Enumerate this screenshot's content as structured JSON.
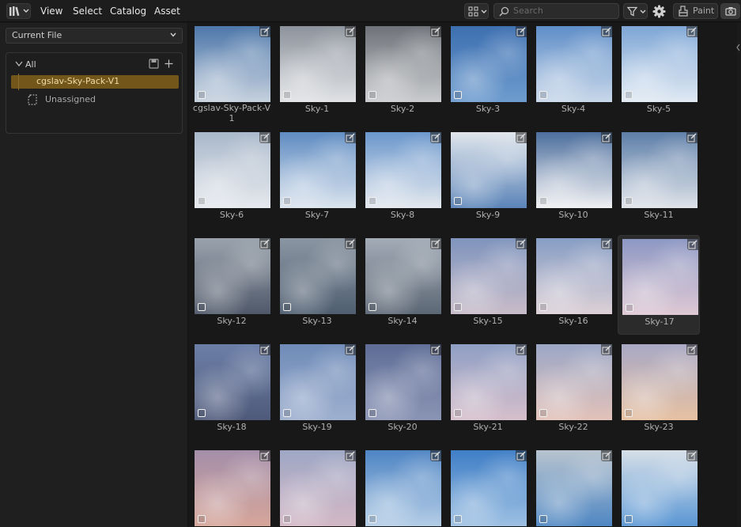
{
  "header": {
    "menu": [
      "View",
      "Select",
      "Catalog",
      "Asset"
    ],
    "search_placeholder": "Search",
    "paint_label": "Paint"
  },
  "sidebar": {
    "library": "Current File",
    "catalog_root": "All",
    "catalogs": [
      "cgslav-Sky-Pack-V1",
      "Unassigned"
    ]
  },
  "assets": [
    {
      "name": "cgslav-Sky-Pack-V1",
      "top": "#4d77aa",
      "bottom": "#c6d1de"
    },
    {
      "name": "Sky-1",
      "top": "#8d939c",
      "bottom": "#e0e2e5"
    },
    {
      "name": "Sky-2",
      "top": "#6f7379",
      "bottom": "#c9cbce"
    },
    {
      "name": "Sky-3",
      "top": "#3d6fb0",
      "bottom": "#6e9ccf"
    },
    {
      "name": "Sky-4",
      "top": "#5f8ec8",
      "bottom": "#c9d8ea"
    },
    {
      "name": "Sky-5",
      "top": "#7ea6d6",
      "bottom": "#e1eaf3"
    },
    {
      "name": "Sky-6",
      "top": "#a9b8ca",
      "bottom": "#e6e9ee"
    },
    {
      "name": "Sky-7",
      "top": "#5f8cc2",
      "bottom": "#dbe4ee"
    },
    {
      "name": "Sky-8",
      "top": "#6b97cc",
      "bottom": "#e3e8ee"
    },
    {
      "name": "Sky-9",
      "top": "#e1e6ec",
      "bottom": "#5b84b8"
    },
    {
      "name": "Sky-10",
      "top": "#4d6f9e",
      "bottom": "#f0f0f2"
    },
    {
      "name": "Sky-11",
      "top": "#5d7ea8",
      "bottom": "#dfe3e9"
    },
    {
      "name": "Sky-12",
      "top": "#9aa3ad",
      "bottom": "#50596a"
    },
    {
      "name": "Sky-13",
      "top": "#8b96a3",
      "bottom": "#4f5e70"
    },
    {
      "name": "Sky-14",
      "top": "#a3acb7",
      "bottom": "#5c6775"
    },
    {
      "name": "Sky-15",
      "top": "#7f94bd",
      "bottom": "#c8bcc9"
    },
    {
      "name": "Sky-16",
      "top": "#879dc4",
      "bottom": "#dcd0d6"
    },
    {
      "name": "Sky-17",
      "top": "#8d98c4",
      "bottom": "#dfc9d4"
    },
    {
      "name": "Sky-18",
      "top": "#6c7fa8",
      "bottom": "#4f5a7a"
    },
    {
      "name": "Sky-19",
      "top": "#6f8bb8",
      "bottom": "#9eb0cf"
    },
    {
      "name": "Sky-20",
      "top": "#5f6d97",
      "bottom": "#8a94b4"
    },
    {
      "name": "Sky-21",
      "top": "#8f9fc4",
      "bottom": "#d6bfcb"
    },
    {
      "name": "Sky-22",
      "top": "#9ba7c6",
      "bottom": "#e3c2b9"
    },
    {
      "name": "Sky-23",
      "top": "#a9a9c5",
      "bottom": "#e7c1a2"
    },
    {
      "name": "",
      "top": "#a48ea9",
      "bottom": "#d6a69a"
    },
    {
      "name": "",
      "top": "#9fa7c5",
      "bottom": "#d3b8c5"
    },
    {
      "name": "",
      "top": "#4f85c4",
      "bottom": "#b4cde6"
    },
    {
      "name": "",
      "top": "#3f7ec6",
      "bottom": "#9ec1e3"
    },
    {
      "name": "",
      "top": "#b8c4cf",
      "bottom": "#4f87c3"
    },
    {
      "name": "",
      "top": "#d6dfe8",
      "bottom": "#5b97d4"
    }
  ]
}
